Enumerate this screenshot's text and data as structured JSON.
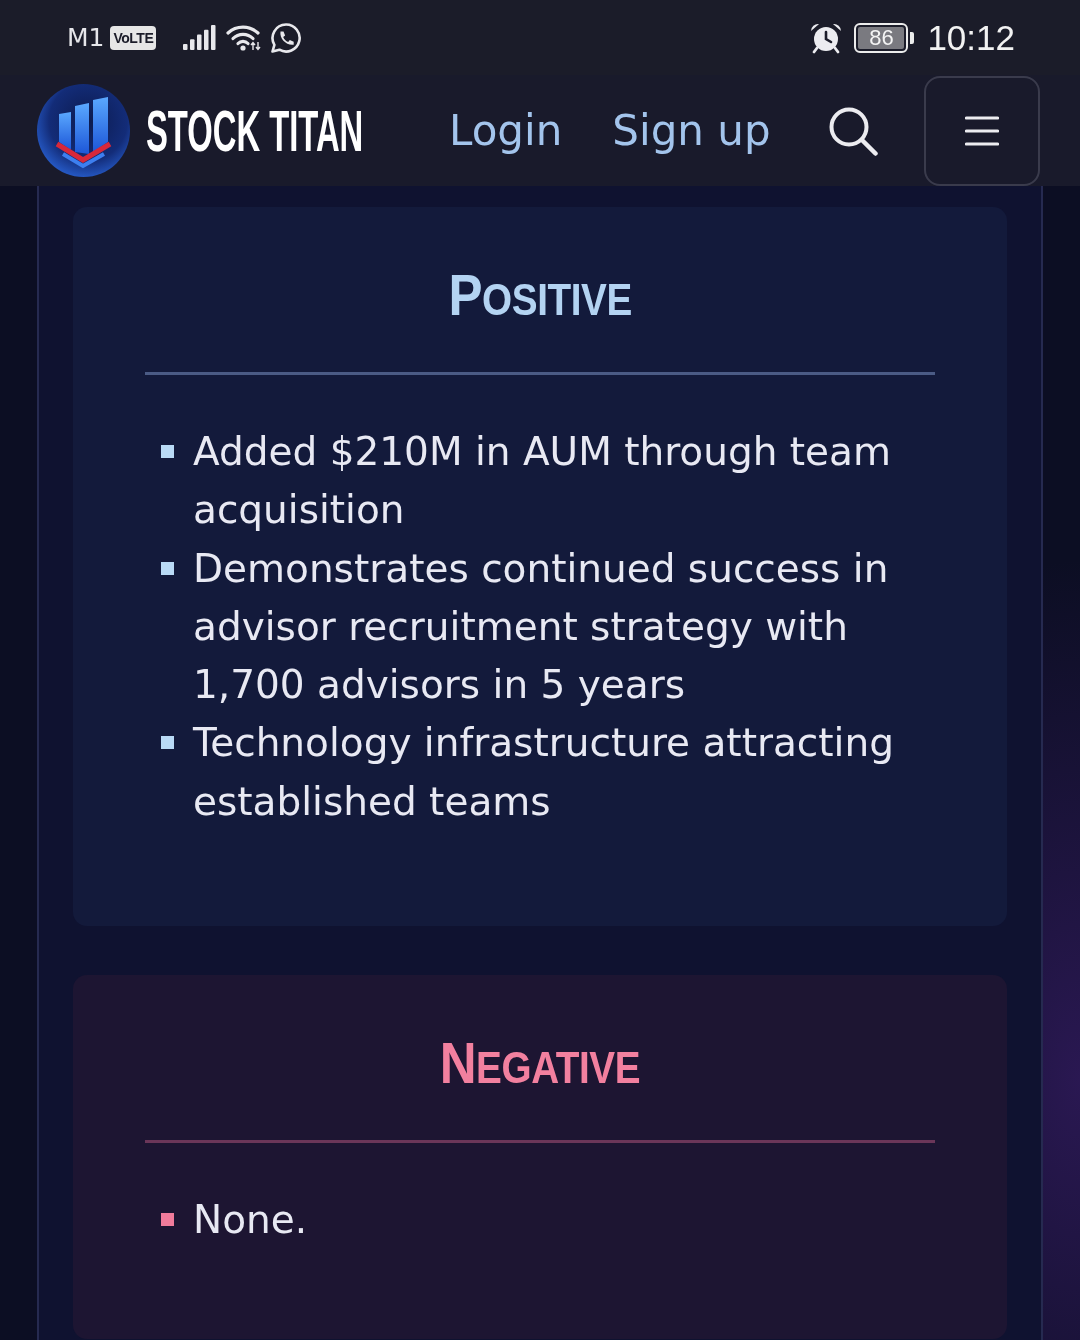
{
  "status_bar": {
    "carrier": "M1",
    "network_badge": "VoLTE",
    "battery": "86",
    "time": "10:12"
  },
  "nav": {
    "brand": "STOCK TITAN",
    "links": [
      "Login",
      "Sign up"
    ]
  },
  "sections": [
    {
      "kind": "positive",
      "title": "POSITIVE",
      "items": [
        "Added $210M in AUM through team acquisition",
        "Demonstrates continued success in advisor recruitment strategy with 1,700 advisors in 5 years",
        "Technology infrastructure attracting established teams"
      ]
    },
    {
      "kind": "negative",
      "title": "NEGATIVE",
      "items": [
        "None."
      ]
    }
  ]
}
